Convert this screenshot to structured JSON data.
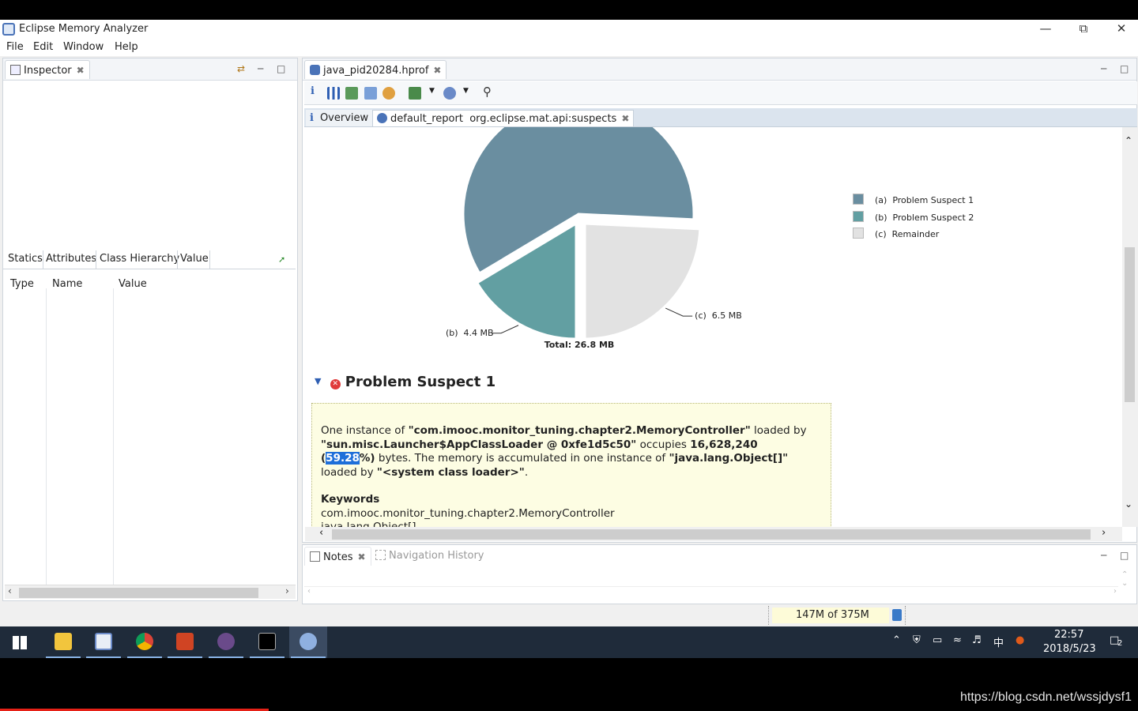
{
  "window": {
    "title": "Eclipse Memory Analyzer"
  },
  "menu": [
    "File",
    "Edit",
    "Window",
    "Help"
  ],
  "inspector": {
    "tab": "Inspector",
    "tabs": [
      "Statics",
      "Attributes",
      "Class Hierarchy",
      "Value"
    ],
    "columns": [
      "Type",
      "Name",
      "Value"
    ]
  },
  "editor": {
    "tab": "java_pid20284.hprof",
    "subtabs": [
      "Overview",
      "default_report  org.eclipse.mat.api:suspects"
    ]
  },
  "chart_data": {
    "type": "pie",
    "total_label": "Total: 26.8 MB",
    "slices": [
      {
        "legend": "(a)  Problem Suspect 1",
        "value": 15.9,
        "color": "#6a8ea0",
        "label": ""
      },
      {
        "legend": "(b)  Problem Suspect 2",
        "value": 4.4,
        "color": "#629fa2",
        "label": "(b)  4.4 MB"
      },
      {
        "legend": "(c)  Remainder",
        "value": 6.5,
        "color": "#e2e2e2",
        "label": "(c)  6.5 MB"
      }
    ]
  },
  "suspect": {
    "heading": "Problem Suspect 1",
    "t1": "One instance of ",
    "class_name": "\"com.imooc.monitor_tuning.chapter2.MemoryController\"",
    "t2": " loaded by ",
    "loader": "\"sun.misc.Launcher$AppClassLoader @ 0xfe1d5c50\"",
    "t3": " occupies ",
    "bytes": "16,628,240",
    "t4": " (",
    "percent": "59.28",
    "t5": "%)",
    "t6": " bytes. The memory is accumulated in one instance of ",
    "obj": "\"java.lang.Object[]\"",
    "t7": " loaded by ",
    "sysloader": "\"<system class loader>\"",
    "t8": ".",
    "keywords_title": "Keywords",
    "keyword1": "com.imooc.monitor_tuning.chapter2.MemoryController",
    "keyword2": "java.lang.Object[]"
  },
  "bottom": {
    "notes_tab": "Notes",
    "history_tab": "Navigation History"
  },
  "status": {
    "heap": "147M of 375M"
  },
  "taskbar": {
    "time": "22:57",
    "date": "2018/5/23",
    "ime": "中",
    "notif_count": "2"
  },
  "watermark": "https://blog.csdn.net/wssjdysf1"
}
